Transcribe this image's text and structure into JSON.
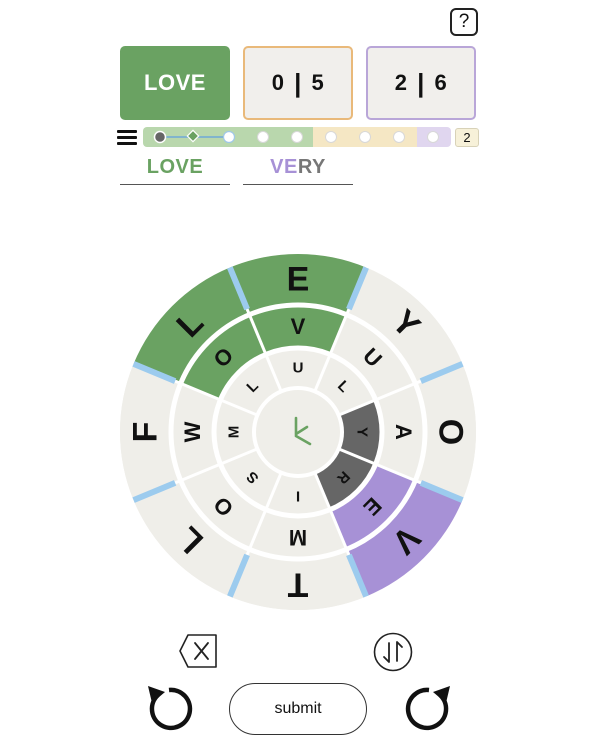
{
  "help": {
    "label": "?"
  },
  "found_word": "LOVE",
  "scores": [
    {
      "left": "0",
      "sep": "|",
      "right": "5"
    },
    {
      "left": "2",
      "sep": "|",
      "right": "6"
    }
  ],
  "progress": {
    "nodes": 9,
    "current_node": 2,
    "level": "2"
  },
  "slots": {
    "word1": "LOVE",
    "word2_colored": "VE",
    "word2_rest": "RY"
  },
  "wheel": {
    "outer": [
      "E",
      "Y",
      "O",
      "V",
      "T",
      "L",
      "F",
      "L"
    ],
    "middle": [
      "V",
      "U",
      "A",
      "E",
      "M",
      "O",
      "W",
      "O"
    ],
    "inner": [
      "U",
      "L",
      "Y",
      "R",
      "I",
      "S",
      "M",
      "L"
    ],
    "colors": {
      "green": "#6aa262",
      "purple": "#a791d6",
      "gray": "#666666",
      "ring": "#efeee9",
      "accent": "#9ccbee"
    }
  },
  "controls": {
    "backspace_icon": "backspace-icon",
    "swap_icon": "swap-vertical-icon",
    "rotate_left_icon": "rotate-ccw-icon",
    "rotate_right_icon": "rotate-cw-icon",
    "submit_label": "submit"
  }
}
